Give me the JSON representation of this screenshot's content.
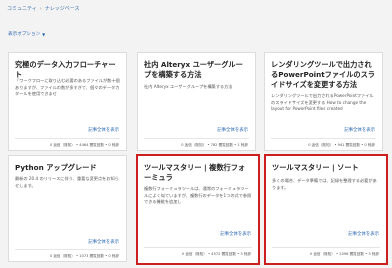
{
  "breadcrumb": {
    "root": "コミュニティ",
    "current": "ナレッジベース"
  },
  "filter_label": "表示オプション",
  "cards": [
    {
      "title": "究極のデータ入力フローチャート",
      "desc": "「ワークフローに取り込む必要のあるファイルが数十個ありますが、ファイルの数が多すぎて、個々のデータカタールを使用できませ",
      "more": "記事全体を表示",
      "stats": "0 返信（既知） • 4464 閲覧回数 • 0 賛辞"
    },
    {
      "title": "社内 Alteryx ユーザーグループを構築する方法",
      "desc": "社内 Alteryx ユーザーグループを構築する方法",
      "more": "記事全体を表示",
      "stats": "0 返信（既知） • 782 閲覧回数 • 1 賛辞"
    },
    {
      "title": "レンダリングツールで出力されるPowerPointファイルのスライドサイズを変更する方法",
      "desc": "レンダリングツールで出力されるPowerPointファイルのスライドサイズを変更する How to change the layout for PowerPoint files created",
      "more": "記事全体を表示",
      "stats": "0 返信（既知） • 941 閲覧回数 • 0 賛辞"
    },
    {
      "title": "Python アップグレード",
      "desc": "最新の 20.4 のリリースに伴う、重要な変更点をお知らせします。",
      "more": "記事全体を表示",
      "stats": "0 返信（既知） • 1073 閲覧回数 • 0 賛辞"
    },
    {
      "title": "ツールマスタリー | 複数行フォーミュラ",
      "desc": "複数行フォーミュラツールは、通常のフォーミュラツールによく似ていますが、複数行のデータを1つの式で参照できる機能を追加し",
      "more": "記事全体を表示",
      "stats": "0 返信（既知） • 4572 閲覧回数 • 3 賛辞"
    },
    {
      "title": "ツールマスタリー | ソート",
      "desc": "多くの場合、データ準備では、記録を整理する必要があります。",
      "more": "記事全体を表示",
      "stats": "0 返信（既知） • 2096 閲覧回数 • 3 賛辞"
    }
  ]
}
